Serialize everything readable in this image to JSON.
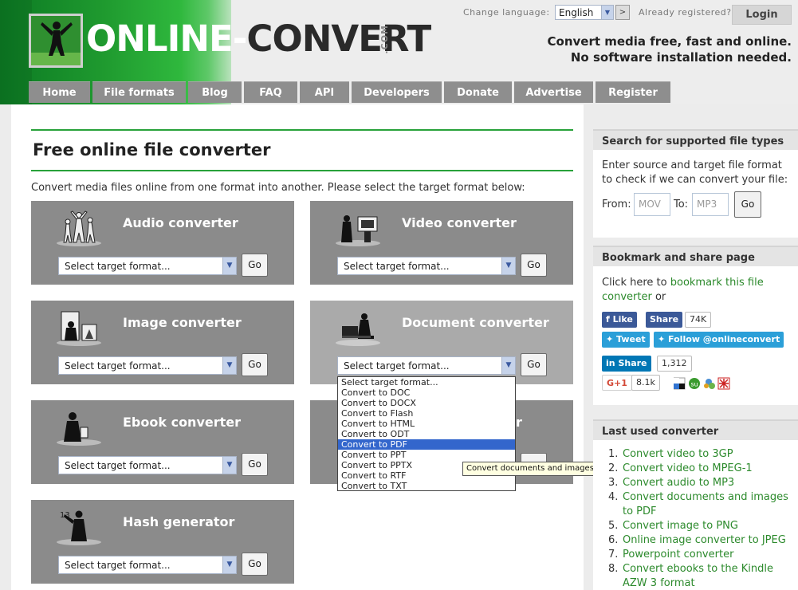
{
  "header": {
    "logo_text_light": "ONLINE-",
    "logo_text_dark": "CONVERT",
    "logo_suffix": ".COM",
    "change_language_label": "Change language:",
    "language_value": "English",
    "language_go": ">",
    "already_registered": "Already registered?",
    "login_label": "Login",
    "tagline_line1": "Convert media free, fast and online.",
    "tagline_line2": "No software installation needed."
  },
  "nav": [
    "Home",
    "File formats",
    "Blog",
    "FAQ",
    "API",
    "Developers",
    "Donate",
    "Advertise",
    "Register"
  ],
  "main": {
    "title": "Free online file converter",
    "description": "Convert media files online from one format into another. Please select the target format below:"
  },
  "converters": [
    {
      "title": "Audio converter",
      "placeholder": "Select target format...",
      "go": "Go",
      "icon": "audio-dancers-icon"
    },
    {
      "title": "Video converter",
      "placeholder": "Select target format...",
      "go": "Go",
      "icon": "video-viewer-icon"
    },
    {
      "title": "Image converter",
      "placeholder": "Select target format...",
      "go": "Go",
      "icon": "image-frame-icon"
    },
    {
      "title": "Document converter",
      "placeholder": "Select target format...",
      "go": "Go",
      "icon": "document-reader-icon"
    },
    {
      "title": "Ebook converter",
      "placeholder": "Select target format...",
      "go": "Go",
      "icon": "ebook-reader-icon"
    },
    {
      "title": "",
      "placeholder": "",
      "go": "",
      "icon": ""
    },
    {
      "title": "Hash generator",
      "placeholder": "Select target format...",
      "go": "Go",
      "icon": "hash-figure-icon"
    }
  ],
  "dropdown_options": [
    "Select target format...",
    "Convert to DOC",
    "Convert to DOCX",
    "Convert to Flash",
    "Convert to HTML",
    "Convert to ODT",
    "Convert to PDF",
    "Convert to PPT",
    "Convert to PPTX",
    "Convert to RTF",
    "Convert to TXT"
  ],
  "dropdown_selected_index": 6,
  "tooltip": "Convert documents and images to PDF",
  "partial_title_fragment": "r",
  "search": {
    "title": "Search for supported file types",
    "text": "Enter source and target file format to check if we can convert your file:",
    "from_label": "From:",
    "from_placeholder": "MOV",
    "to_label": "To:",
    "to_placeholder": "MP3",
    "go": "Go"
  },
  "share": {
    "title": "Bookmark and share page",
    "text_prefix": "Click here to",
    "link_text": "bookmark this file converter",
    "text_suffix": "or",
    "fb_like": "Like",
    "fb_share": "Share",
    "fb_count": "74K",
    "tweet": "Tweet",
    "follow": "Follow @onlineconvert",
    "li_share": "Share",
    "li_count": "1,312",
    "gplus": "G+1",
    "gplus_count": "8.1k"
  },
  "recent": {
    "title": "Last used converter",
    "items": [
      "Convert video to 3GP",
      "Convert video to MPEG-1",
      "Convert audio to MP3",
      "Convert documents and images to PDF",
      "Convert image to PNG",
      "Online image converter to JPEG",
      "Powerpoint converter",
      "Convert ebooks to the Kindle AZW 3 format"
    ]
  },
  "colors": {
    "accent_green": "#28a23a",
    "nav_gray": "#8e8e8e",
    "select_blue": "#3366cc"
  }
}
